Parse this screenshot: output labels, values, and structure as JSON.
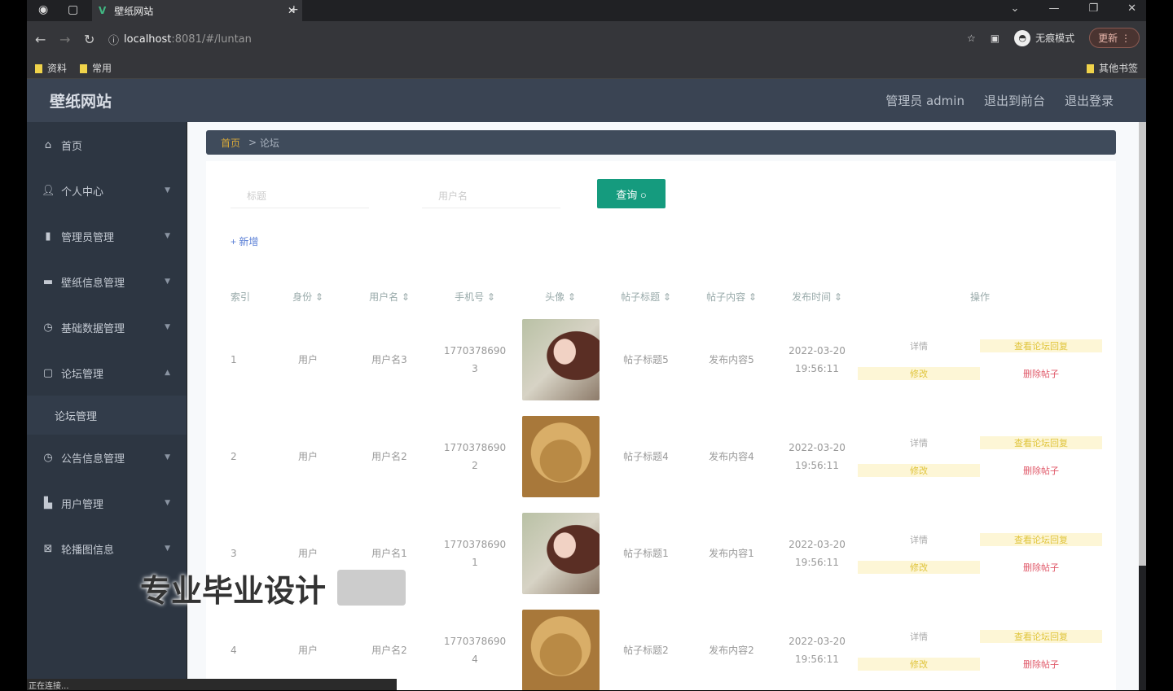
{
  "browser": {
    "tab_title": "壁纸网站",
    "url_host": "localhost",
    "url_rest": ":8081/#/luntan",
    "incognito": "无痕模式",
    "update": "更新",
    "bookmarks": [
      "资料",
      "常用"
    ],
    "other_bookmarks": "其他书签"
  },
  "header": {
    "title": "壁纸网站",
    "links": [
      "管理员 admin",
      "退出到前台",
      "退出登录"
    ]
  },
  "sidebar": {
    "items": [
      {
        "label": "首页",
        "icon": "home-icon"
      },
      {
        "label": "个人中心",
        "icon": "user-icon"
      },
      {
        "label": "管理员管理",
        "icon": "chart-icon"
      },
      {
        "label": "壁纸信息管理",
        "icon": "image-icon"
      },
      {
        "label": "基础数据管理",
        "icon": "clock-icon"
      },
      {
        "label": "论坛管理",
        "icon": "chat-icon"
      }
    ],
    "sub": "论坛管理",
    "items2": [
      {
        "label": "公告信息管理",
        "icon": "clock-icon"
      },
      {
        "label": "用户管理",
        "icon": "users-icon"
      },
      {
        "label": "轮播图信息",
        "icon": "carousel-icon"
      }
    ]
  },
  "breadcrumb": {
    "home": "首页",
    "current": "论坛"
  },
  "search": {
    "title_placeholder": "标题",
    "user_placeholder": "用户名",
    "query": "查询",
    "add": "+ 新增"
  },
  "table": {
    "headers": [
      "索引",
      "身份 ⇕",
      "用户名 ⇕",
      "手机号 ⇕",
      "头像 ⇕",
      "帖子标题 ⇕",
      "帖子内容 ⇕",
      "发布时间 ⇕",
      "操作"
    ],
    "rows": [
      {
        "idx": "1",
        "role": "用户",
        "user": "用户名3",
        "phone": "17703786903",
        "img": "girl",
        "title": "帖子标题5",
        "content": "发布内容5",
        "time": "2022-03-20 19:56:11"
      },
      {
        "idx": "2",
        "role": "用户",
        "user": "用户名2",
        "phone": "17703786902",
        "img": "dog",
        "title": "帖子标题4",
        "content": "发布内容4",
        "time": "2022-03-20 19:56:11"
      },
      {
        "idx": "3",
        "role": "用户",
        "user": "用户名1",
        "phone": "17703786901",
        "img": "girl",
        "title": "帖子标题1",
        "content": "发布内容1",
        "time": "2022-03-20 19:56:11"
      },
      {
        "idx": "4",
        "role": "用户",
        "user": "用户名2",
        "phone": "17703786904",
        "img": "dog",
        "title": "帖子标题2",
        "content": "发布内容2",
        "time": "2022-03-20 19:56:11"
      }
    ],
    "actions": {
      "detail": "详情",
      "comments": "查看论坛回复",
      "edit": "修改",
      "delete": "删除帖子"
    }
  },
  "watermark": "专业毕业设计",
  "status": "正在连接..."
}
